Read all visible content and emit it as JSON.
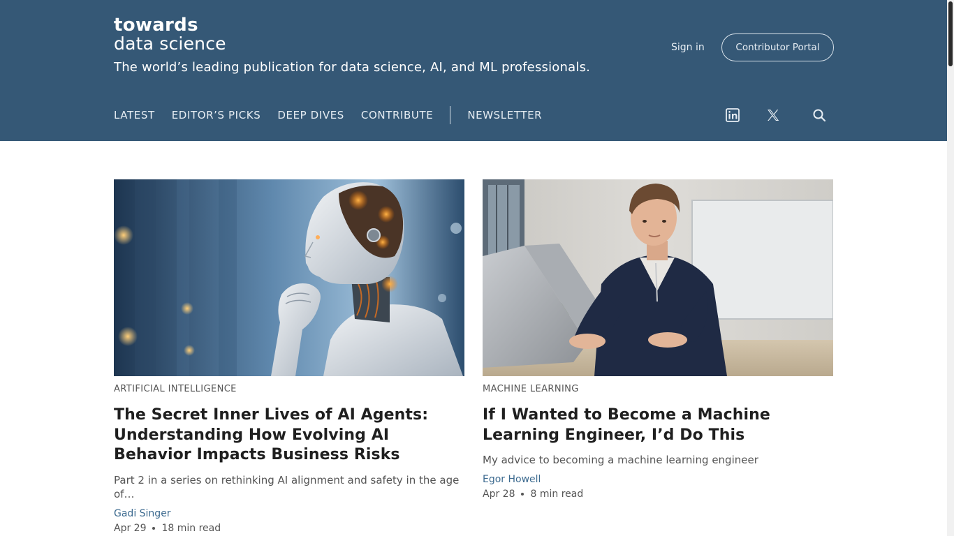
{
  "header": {
    "logo_line1": "towards",
    "logo_line2": "data science",
    "tagline": "The world’s leading publication for data science, AI, and ML professionals.",
    "sign_in": "Sign in",
    "contributor_portal": "Contributor Portal",
    "background_color": "#355876"
  },
  "nav": {
    "items": [
      {
        "label": "LATEST"
      },
      {
        "label": "EDITOR’S PICKS"
      },
      {
        "label": "DEEP DIVES"
      },
      {
        "label": "CONTRIBUTE"
      },
      {
        "label": "NEWSLETTER"
      }
    ],
    "social_icons": [
      "linkedin-icon",
      "x-icon"
    ],
    "search_icon": "search-icon"
  },
  "articles": [
    {
      "image": "robot-thinking-image",
      "category": "ARTIFICIAL INTELLIGENCE",
      "title": "The Secret Inner Lives of AI Agents: Understanding How Evolving AI Behavior Impacts Business Risks",
      "subtitle": "Part 2 in a series on rethinking AI alignment and safety in the age of…",
      "author": "Gadi Singer",
      "date": "Apr 29",
      "read_time": "18 min read"
    },
    {
      "image": "man-at-laptop-image",
      "category": "MACHINE LEARNING",
      "title": "If I Wanted to Become a Machine Learning Engineer, I’d Do This",
      "subtitle": "My advice to becoming a machine learning engineer",
      "author": "Egor Howell",
      "date": "Apr 28",
      "read_time": "8 min read"
    }
  ]
}
